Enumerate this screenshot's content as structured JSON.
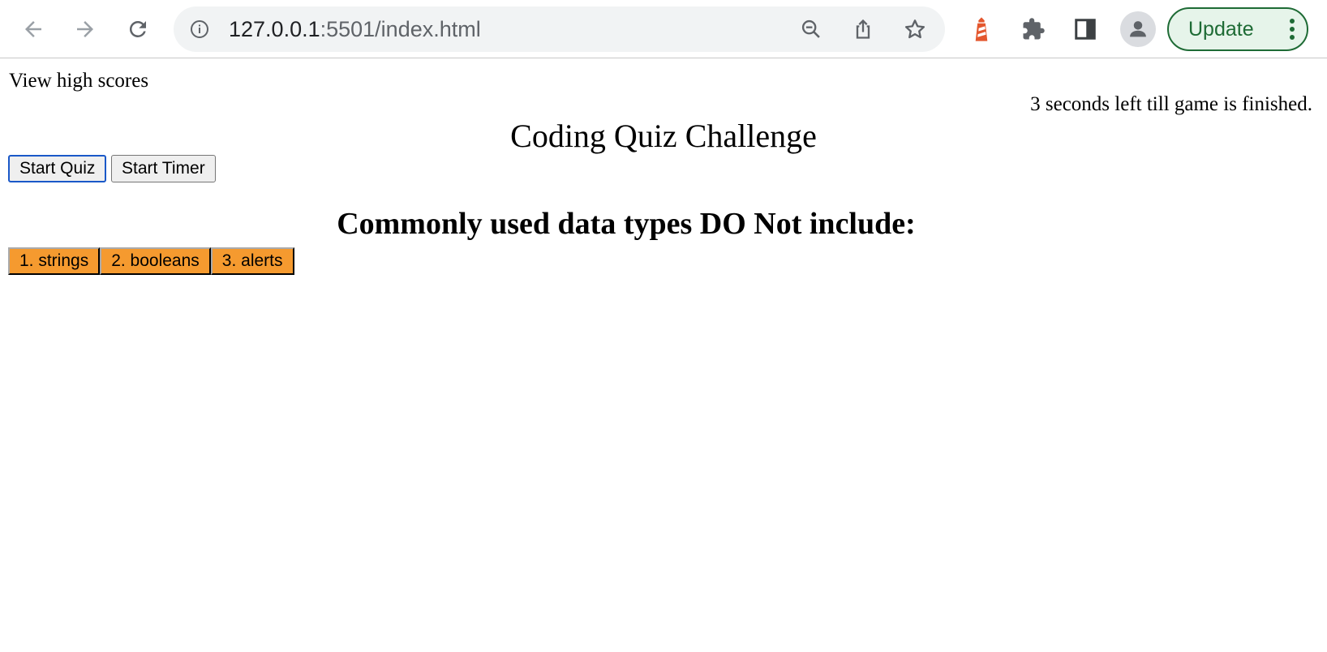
{
  "browser": {
    "url_host": "127.0.0.1",
    "url_rest": ":5501/index.html",
    "update_label": "Update"
  },
  "page": {
    "view_high_scores": "View high scores",
    "timer_text": "3 seconds left till game is finished.",
    "title": "Coding Quiz Challenge",
    "start_quiz_label": "Start Quiz",
    "start_timer_label": "Start Timer",
    "question": "Commonly used data types DO Not include:",
    "answers": [
      "1. strings",
      "2. booleans",
      "3. alerts"
    ]
  },
  "colors": {
    "answer_bg": "#f59a2f",
    "update_green": "#1e6b35",
    "focus_blue": "#1a58c8"
  },
  "icons": [
    "back-arrow-icon",
    "forward-arrow-icon",
    "reload-icon",
    "info-icon",
    "zoom-out-icon",
    "share-icon",
    "star-icon",
    "lighthouse-icon",
    "puzzle-icon",
    "side-panel-icon",
    "profile-icon",
    "more-vert-icon"
  ]
}
